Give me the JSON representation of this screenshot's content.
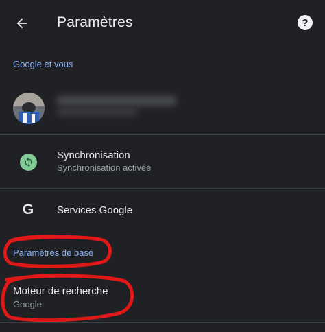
{
  "appbar": {
    "title": "Paramètres",
    "back_icon": "arrow-back-icon",
    "help_icon": "help-icon",
    "help_glyph": "?"
  },
  "sections": {
    "google_and_you": "Google et vous",
    "basics": "Paramètres de base"
  },
  "sync": {
    "title": "Synchronisation",
    "subtitle": "Synchronisation activée",
    "icon": "sync-icon"
  },
  "services": {
    "title": "Services Google",
    "icon": "google-g-icon",
    "glyph": "G"
  },
  "search_engine": {
    "title": "Moteur de recherche",
    "subtitle": "Google"
  },
  "colors": {
    "background": "#202124",
    "accent": "#8ab4f8",
    "sync_green": "#81c995",
    "annotation_red": "#e01818"
  }
}
